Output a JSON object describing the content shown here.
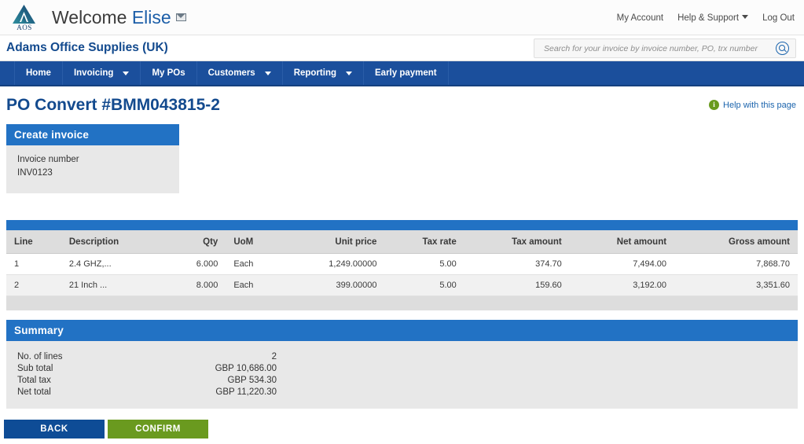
{
  "header": {
    "logo_text": "AOS",
    "welcome_prefix": "Welcome",
    "user_name": "Elise",
    "mail_icon": "envelope-icon",
    "links": [
      {
        "label": "My Account",
        "has_caret": false
      },
      {
        "label": "Help & Support",
        "has_caret": true
      },
      {
        "label": "Log Out",
        "has_caret": false
      }
    ]
  },
  "company_bar": {
    "company_name": "Adams Office Supplies (UK)",
    "search": {
      "placeholder": "Search for your invoice by invoice number, PO, trx number",
      "value": "",
      "icon": "search-icon"
    }
  },
  "nav": {
    "items": [
      {
        "label": "Home",
        "has_caret": false
      },
      {
        "label": "Invoicing",
        "has_caret": true
      },
      {
        "label": "My POs",
        "has_caret": false
      },
      {
        "label": "Customers",
        "has_caret": true
      },
      {
        "label": "Reporting",
        "has_caret": true
      },
      {
        "label": "Early payment",
        "has_caret": false
      }
    ]
  },
  "page": {
    "title": "PO Convert #BMM043815-2",
    "help_label": "Help with this page",
    "help_icon_glyph": "i"
  },
  "create_invoice": {
    "panel_title": "Create invoice",
    "invoice_number_label": "Invoice number",
    "invoice_number_value": "INV0123"
  },
  "lines": {
    "columns": [
      "Line",
      "Description",
      "Qty",
      "UoM",
      "Unit price",
      "Tax rate",
      "Tax amount",
      "Net amount",
      "Gross amount"
    ],
    "rows": [
      {
        "line": "1",
        "description": "2.4 GHZ,...",
        "qty": "6.000",
        "uom": "Each",
        "unit_price": "1,249.00000",
        "tax_rate": "5.00",
        "tax_amount": "374.70",
        "net_amount": "7,494.00",
        "gross_amount": "7,868.70"
      },
      {
        "line": "2",
        "description": "21 Inch ...",
        "qty": "8.000",
        "uom": "Each",
        "unit_price": "399.00000",
        "tax_rate": "5.00",
        "tax_amount": "159.60",
        "net_amount": "3,192.00",
        "gross_amount": "3,351.60"
      }
    ]
  },
  "summary": {
    "panel_title": "Summary",
    "rows": [
      {
        "label": "No. of lines",
        "value": "2"
      },
      {
        "label": "Sub total",
        "value": "GBP 10,686.00"
      },
      {
        "label": "Total tax",
        "value": "GBP 534.30"
      },
      {
        "label": "Net total",
        "value": "GBP 11,220.30"
      }
    ]
  },
  "footer": {
    "back_label": "BACK",
    "confirm_label": "CONFIRM"
  },
  "colors": {
    "nav_blue": "#1b4f9c",
    "panel_blue": "#2272c4",
    "title_blue": "#134a8e",
    "confirm_green": "#6a9a1f",
    "back_blue": "#0e4c96"
  }
}
